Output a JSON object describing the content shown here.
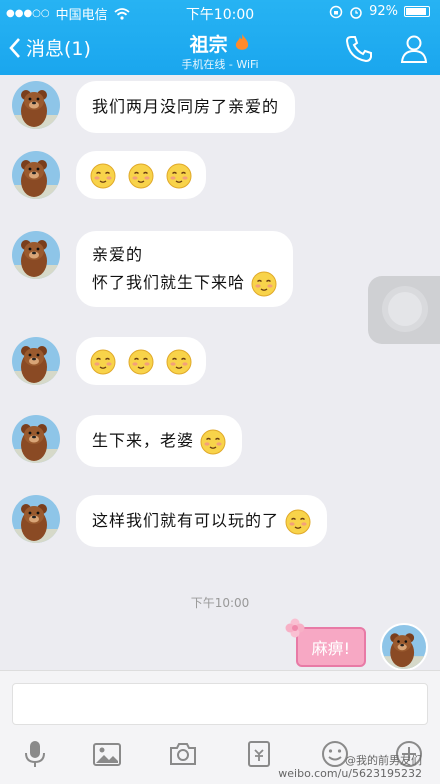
{
  "status_bar": {
    "carrier": "中国电信",
    "time": "下午10:00",
    "battery": "92%"
  },
  "header": {
    "back_label": "消息(1)",
    "title": "祖宗",
    "subtitle": "手机在线 - WiFi"
  },
  "messages": [
    {
      "text": "我们两月没同房了亲爱的"
    },
    {
      "text": ""
    },
    {
      "line1": "亲爱的",
      "line2": "怀了我们就生下来哈"
    },
    {
      "text": ""
    },
    {
      "text": "生下来，老婆"
    },
    {
      "text": "这样我们就有可以玩的了"
    }
  ],
  "timestamp": "下午10:00",
  "outgoing": {
    "text": "麻痹!"
  },
  "watermark": {
    "line1": "@我的前男友们",
    "line2": "weibo.com/u/5623195232"
  },
  "colors": {
    "header": "#1aa6ee",
    "bubble": "#ffffff",
    "out_bubble": "#f7a8c4"
  }
}
